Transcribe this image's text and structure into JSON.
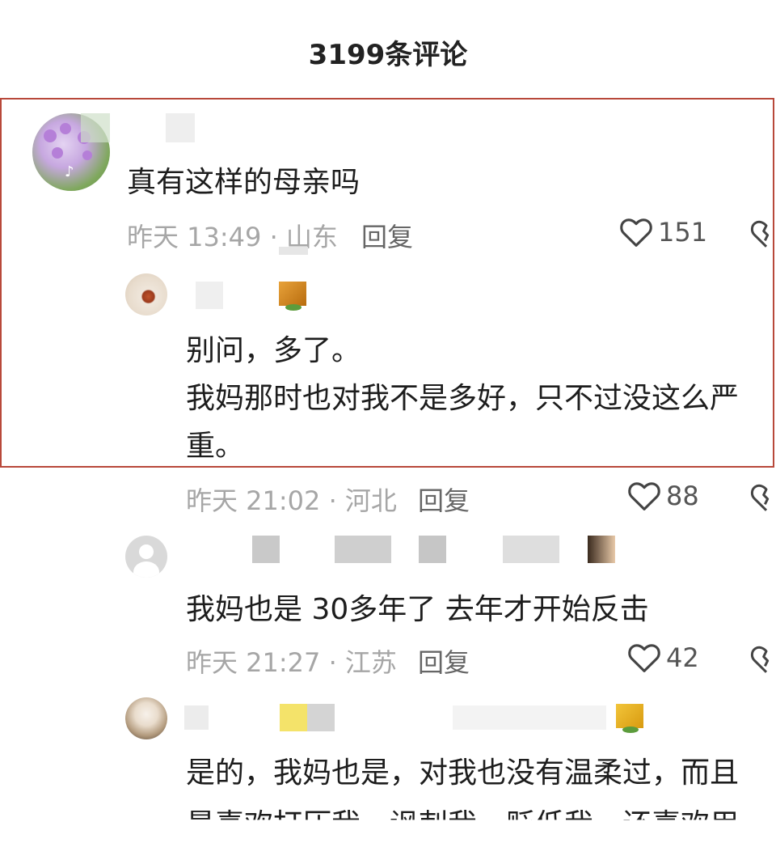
{
  "header": {
    "top_cut_text": "",
    "title": "3199条评论"
  },
  "comments": [
    {
      "text": "真有这样的母亲吗",
      "time_location": "昨天 13:49 · 山东",
      "reply_label": "回复",
      "likes": "151"
    }
  ],
  "replies": [
    {
      "text_line1": "别问，多了。",
      "text_line2": "我妈那时也对我不是多好，只不过没这么严",
      "text_line3": "重。",
      "time_location": "昨天 21:02 · 河北",
      "reply_label": "回复",
      "likes": "88"
    },
    {
      "text_line1": "我妈也是  30多年了 去年才开始反击",
      "time_location": "昨天 21:27 · 江苏",
      "reply_label": "回复",
      "likes": "42"
    },
    {
      "text_line1": "是的，我妈也是，对我也没有温柔过，而且",
      "text_line2": "最喜欢打压我，讽刺我，贬低我，还喜欢用"
    }
  ],
  "icons": {
    "like": "heart-outline-icon",
    "dislike": "broken-heart-icon",
    "avatar_default": "user-avatar-icon",
    "platform": "tiktok-icon"
  },
  "colors": {
    "highlight_border": "#b8483a",
    "meta_gray": "#a6a6a6",
    "badge_gold": "#e8a23a"
  }
}
